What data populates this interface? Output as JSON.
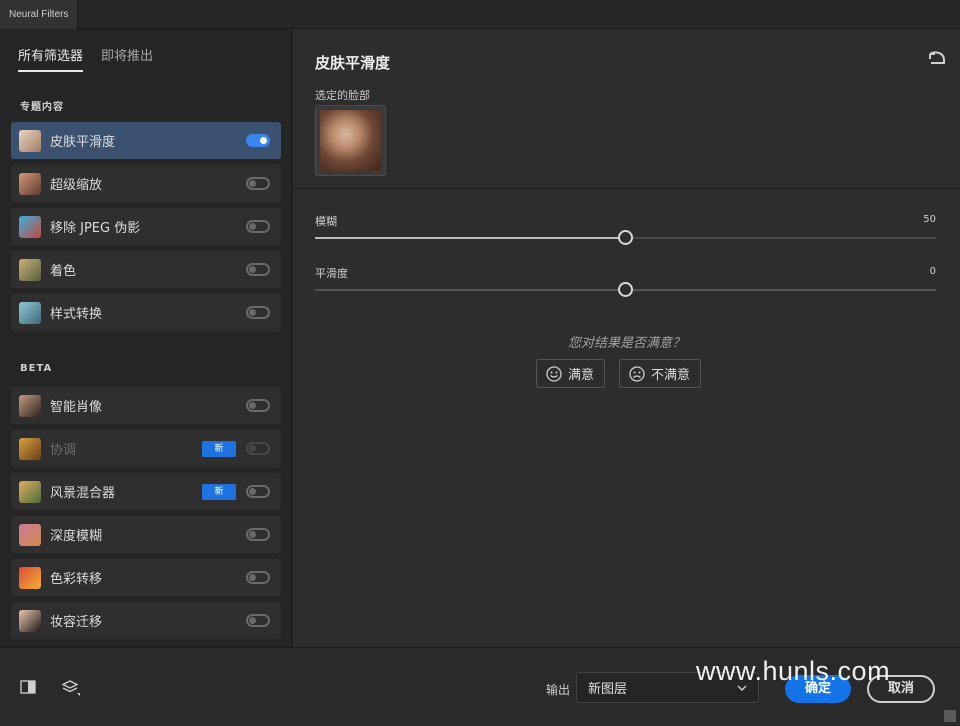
{
  "window": {
    "title": "Neural Filters"
  },
  "sidebar": {
    "tabs": [
      {
        "label": "所有筛选器",
        "active": true
      },
      {
        "label": "即将推出",
        "active": false
      }
    ],
    "featured_label": "专题内容",
    "beta_label": "BETA",
    "featured": [
      {
        "label": "皮肤平滑度",
        "on": true,
        "selected": true,
        "icon": "skin-smoothing-thumb"
      },
      {
        "label": "超级缩放",
        "on": false,
        "icon": "super-zoom-thumb"
      },
      {
        "label": "移除 JPEG 伪影",
        "on": false,
        "icon": "jpeg-artifacts-thumb"
      },
      {
        "label": "着色",
        "on": false,
        "icon": "colorize-thumb"
      },
      {
        "label": "样式转换",
        "on": false,
        "icon": "style-transfer-thumb"
      }
    ],
    "beta": [
      {
        "label": "智能肖像",
        "on": false,
        "icon": "smart-portrait-thumb"
      },
      {
        "label": "协调",
        "on": false,
        "badge": "新",
        "disabled": true,
        "icon": "harmonization-thumb"
      },
      {
        "label": "风景混合器",
        "on": false,
        "badge": "新",
        "icon": "landscape-mixer-thumb"
      },
      {
        "label": "深度模糊",
        "on": false,
        "icon": "depth-blur-thumb"
      },
      {
        "label": "色彩转移",
        "on": false,
        "icon": "color-transfer-thumb"
      },
      {
        "label": "妆容迁移",
        "on": false,
        "icon": "makeup-transfer-thumb"
      }
    ]
  },
  "panel": {
    "title": "皮肤平滑度",
    "face_label": "选定的脸部",
    "sliders": [
      {
        "label": "模糊",
        "value": "50",
        "fraction": 0.5
      },
      {
        "label": "平滑度",
        "value": "0",
        "fraction": 0.5
      }
    ],
    "feedback": {
      "question": "您对结果是否满意？",
      "satisfied": "满意",
      "unsatisfied": "不满意"
    }
  },
  "footer": {
    "output_label": "输出",
    "output_value": "新图层",
    "ok": "确定",
    "cancel": "取消",
    "watermark": "www.hunls.com"
  },
  "colors": {
    "accent": "#1473e6",
    "selected_row": "#3b5170",
    "toggle_on": "#3a86f0"
  }
}
